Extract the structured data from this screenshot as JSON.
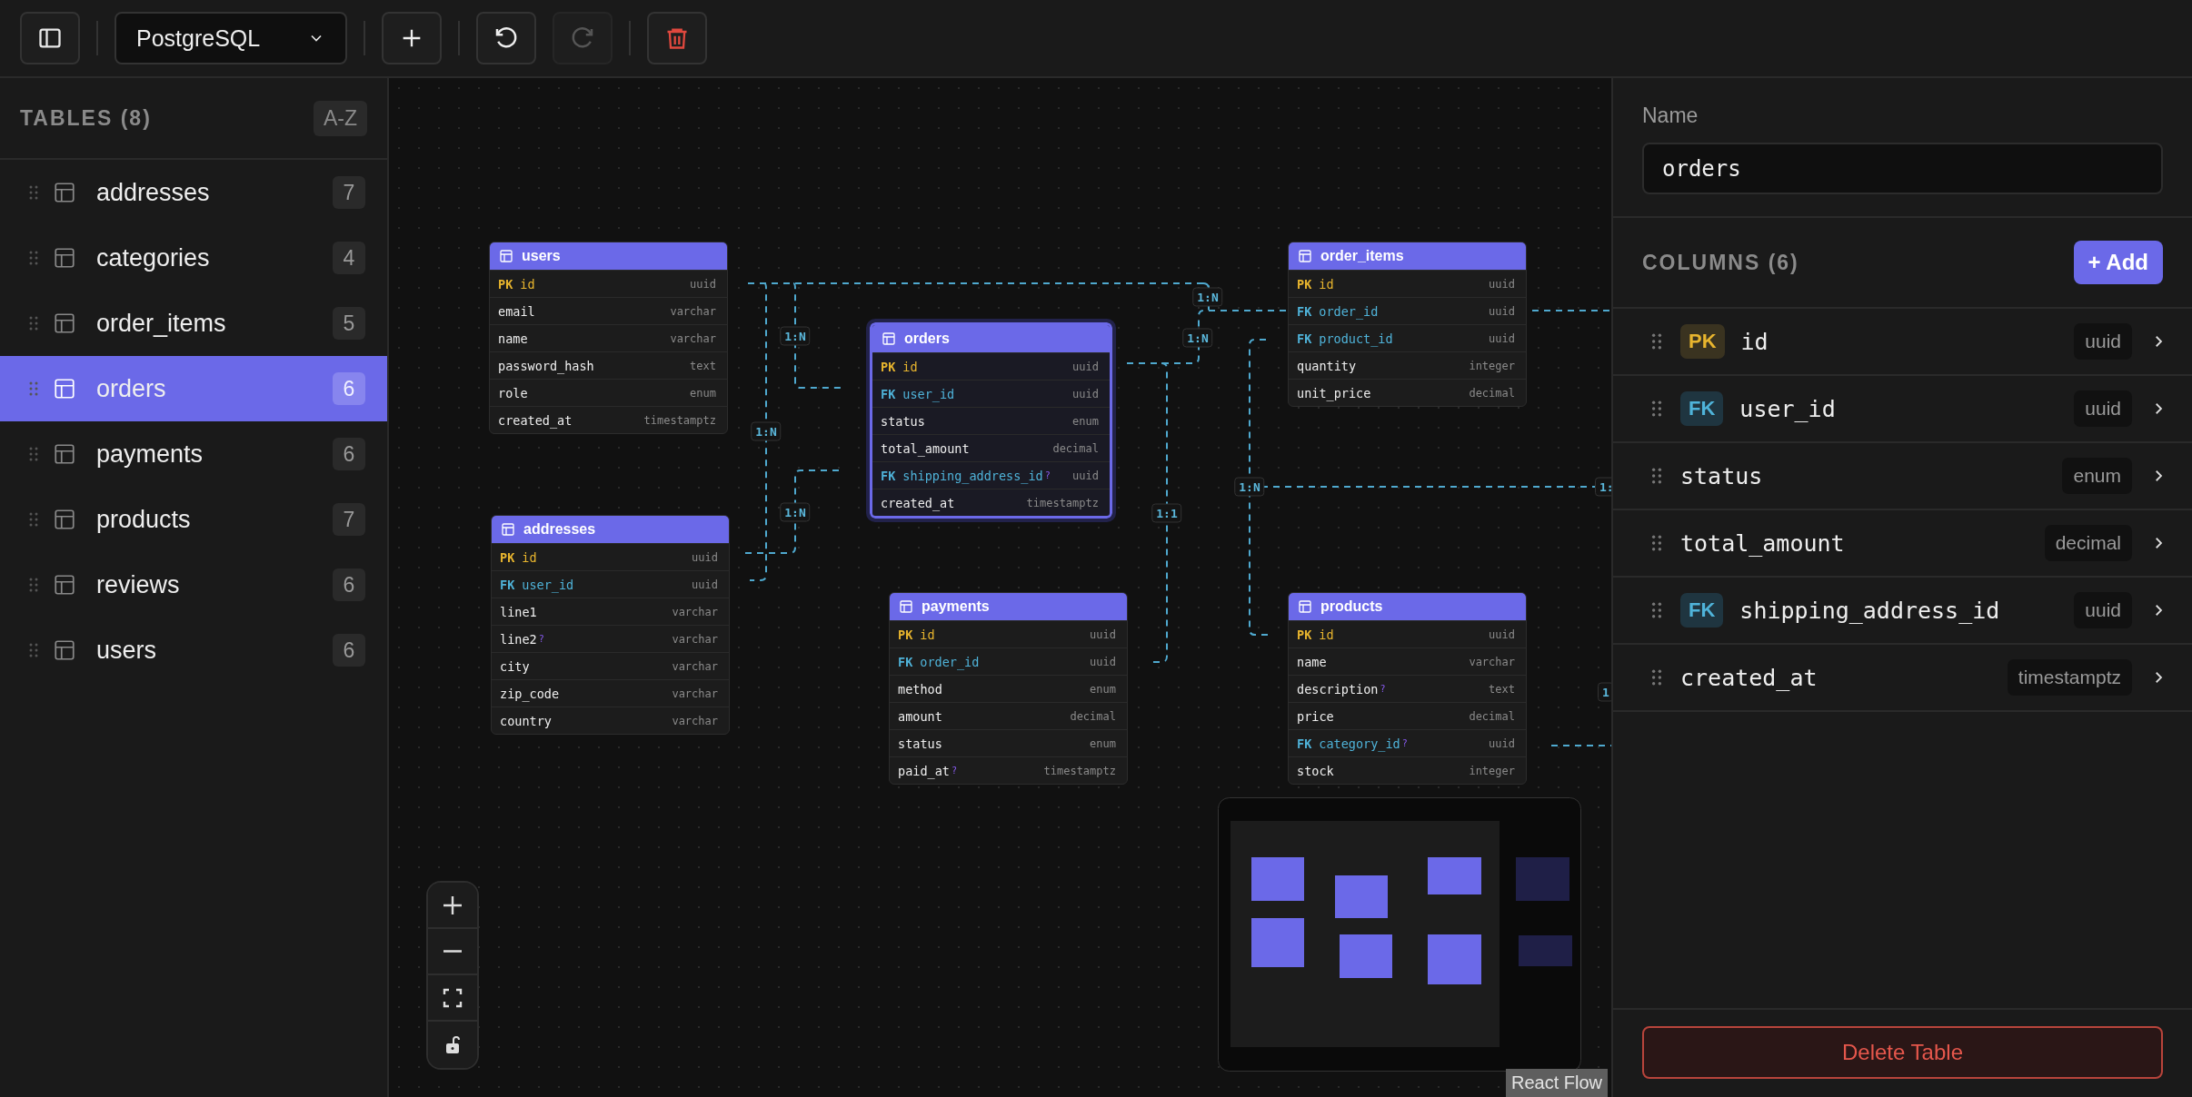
{
  "toolbar": {
    "dialect": "PostgreSQL",
    "actions": [
      {
        "kind": "add",
        "disabled": false
      },
      {
        "kind": "undo",
        "disabled": false
      },
      {
        "kind": "redo",
        "disabled": true
      },
      {
        "kind": "delete",
        "disabled": false
      }
    ]
  },
  "sidebar": {
    "title": "TABLES (8)",
    "sort": "A-Z",
    "items": [
      {
        "name": "addresses",
        "count": "7",
        "selected": false
      },
      {
        "name": "categories",
        "count": "4",
        "selected": false
      },
      {
        "name": "order_items",
        "count": "5",
        "selected": false
      },
      {
        "name": "orders",
        "count": "6",
        "selected": true
      },
      {
        "name": "payments",
        "count": "6",
        "selected": false
      },
      {
        "name": "products",
        "count": "7",
        "selected": false
      },
      {
        "name": "reviews",
        "count": "6",
        "selected": false
      },
      {
        "name": "users",
        "count": "6",
        "selected": false
      }
    ]
  },
  "canvas": {
    "tables": [
      {
        "name": "users",
        "selected": false,
        "fields": [
          {
            "kind": "pk",
            "key": "PK",
            "name": "id",
            "type": "uuid"
          },
          {
            "kind": "plain",
            "name": "email",
            "type": "varchar"
          },
          {
            "kind": "plain",
            "name": "name",
            "type": "varchar"
          },
          {
            "kind": "plain",
            "name": "password_hash",
            "type": "text"
          },
          {
            "kind": "plain",
            "name": "role",
            "type": "enum"
          },
          {
            "kind": "plain",
            "name": "created_at",
            "type": "timestamptz"
          }
        ]
      },
      {
        "name": "orders",
        "selected": true,
        "fields": [
          {
            "kind": "pk",
            "key": "PK",
            "name": "id",
            "type": "uuid"
          },
          {
            "kind": "fk",
            "key": "FK",
            "name": "user_id",
            "type": "uuid"
          },
          {
            "kind": "plain",
            "name": "status",
            "type": "enum"
          },
          {
            "kind": "plain",
            "name": "total_amount",
            "type": "decimal"
          },
          {
            "kind": "fk",
            "key": "FK",
            "name": "shipping_address_id",
            "mark": "?",
            "type": "uuid"
          },
          {
            "kind": "plain",
            "name": "created_at",
            "type": "timestamptz"
          }
        ]
      },
      {
        "name": "order_items",
        "selected": false,
        "fields": [
          {
            "kind": "pk",
            "key": "PK",
            "name": "id",
            "type": "uuid"
          },
          {
            "kind": "fk",
            "key": "FK",
            "name": "order_id",
            "type": "uuid"
          },
          {
            "kind": "fk",
            "key": "FK",
            "name": "product_id",
            "type": "uuid"
          },
          {
            "kind": "plain",
            "name": "quantity",
            "type": "integer"
          },
          {
            "kind": "plain",
            "name": "unit_price",
            "type": "decimal"
          }
        ]
      },
      {
        "name": "addresses",
        "selected": false,
        "fields": [
          {
            "kind": "pk",
            "key": "PK",
            "name": "id",
            "type": "uuid"
          },
          {
            "kind": "fk",
            "key": "FK",
            "name": "user_id",
            "type": "uuid"
          },
          {
            "kind": "plain",
            "name": "line1",
            "type": "varchar"
          },
          {
            "kind": "plain",
            "name": "line2",
            "mark": "?",
            "type": "varchar"
          },
          {
            "kind": "plain",
            "name": "city",
            "type": "varchar"
          },
          {
            "kind": "plain",
            "name": "zip_code",
            "type": "varchar"
          },
          {
            "kind": "plain",
            "name": "country",
            "type": "varchar"
          }
        ]
      },
      {
        "name": "payments",
        "selected": false,
        "fields": [
          {
            "kind": "pk",
            "key": "PK",
            "name": "id",
            "type": "uuid"
          },
          {
            "kind": "fk",
            "key": "FK",
            "name": "order_id",
            "type": "uuid"
          },
          {
            "kind": "plain",
            "name": "method",
            "type": "enum"
          },
          {
            "kind": "plain",
            "name": "amount",
            "type": "decimal"
          },
          {
            "kind": "plain",
            "name": "status",
            "type": "enum"
          },
          {
            "kind": "plain",
            "name": "paid_at",
            "mark": "?",
            "type": "timestamptz"
          }
        ]
      },
      {
        "name": "products",
        "selected": false,
        "fields": [
          {
            "kind": "pk",
            "key": "PK",
            "name": "id",
            "type": "uuid"
          },
          {
            "kind": "plain",
            "name": "name",
            "type": "varchar"
          },
          {
            "kind": "plain",
            "name": "description",
            "mark": "?",
            "type": "text"
          },
          {
            "kind": "plain",
            "name": "price",
            "type": "decimal"
          },
          {
            "kind": "fk",
            "key": "FK",
            "name": "category_id",
            "mark": "?",
            "type": "uuid"
          },
          {
            "kind": "plain",
            "name": "stock",
            "type": "integer"
          }
        ]
      }
    ],
    "edge_labels": [
      "1:N",
      "1:N",
      "1:N",
      "1:N",
      "1:N",
      "1:1",
      "1:N",
      "1:",
      "1"
    ],
    "attribution": "React Flow"
  },
  "panel": {
    "name_label": "Name",
    "name_value": "orders",
    "columns_title": "COLUMNS (6)",
    "add_button": "+ Add",
    "columns": [
      {
        "kind": "pk",
        "key": "PK",
        "name": "id",
        "type": "uuid"
      },
      {
        "kind": "fk",
        "key": "FK",
        "name": "user_id",
        "type": "uuid"
      },
      {
        "kind": "plain",
        "name": "status",
        "type": "enum"
      },
      {
        "kind": "plain",
        "name": "total_amount",
        "type": "decimal"
      },
      {
        "kind": "fk",
        "key": "FK",
        "name": "shipping_address_id",
        "type": "uuid"
      },
      {
        "kind": "plain",
        "name": "created_at",
        "type": "timestamptz"
      }
    ],
    "delete_button": "Delete Table"
  }
}
